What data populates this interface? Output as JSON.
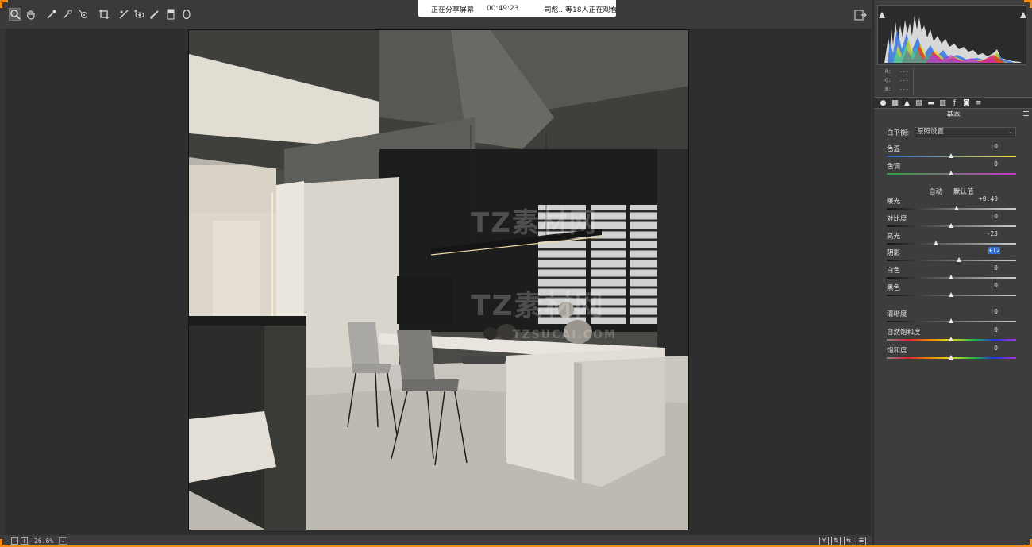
{
  "share_banner": {
    "status": "正在分享屏幕",
    "timer": "00:49:23",
    "viewers": "司彪...等18人正在观看"
  },
  "status_bar": {
    "zoom": "26.6%"
  },
  "histogram": {
    "r_label": "R:",
    "g_label": "G:",
    "b_label": "B:",
    "r_value": "---",
    "g_value": "---",
    "b_value": "---"
  },
  "panel": {
    "section_title": "基本",
    "white_balance_label": "白平衡:",
    "white_balance_value": "原照设置",
    "auto_label": "自动",
    "default_label": "默认值",
    "sliders": [
      {
        "label": "色温",
        "value": "0",
        "fraction": 0.5
      },
      {
        "label": "色调",
        "value": "0",
        "fraction": 0.5
      },
      {
        "label": "曝光",
        "value": "+0.40",
        "fraction": 0.54
      },
      {
        "label": "对比度",
        "value": "0",
        "fraction": 0.5
      },
      {
        "label": "高光",
        "value": "-23",
        "fraction": 0.385
      },
      {
        "label": "阴影",
        "value": "+12",
        "fraction": 0.56
      },
      {
        "label": "白色",
        "value": "0",
        "fraction": 0.5
      },
      {
        "label": "黑色",
        "value": "0",
        "fraction": 0.5
      },
      {
        "label": "清晰度",
        "value": "0",
        "fraction": 0.5
      },
      {
        "label": "自然饱和度",
        "value": "0",
        "fraction": 0.5
      },
      {
        "label": "饱和度",
        "value": "0",
        "fraction": 0.5
      }
    ]
  },
  "watermark": {
    "brand": "TZ素材网",
    "domain": "TZSUCAI.COM"
  },
  "colors": {
    "accent": "#f28a1e",
    "highlight": "#2c6fd1"
  }
}
